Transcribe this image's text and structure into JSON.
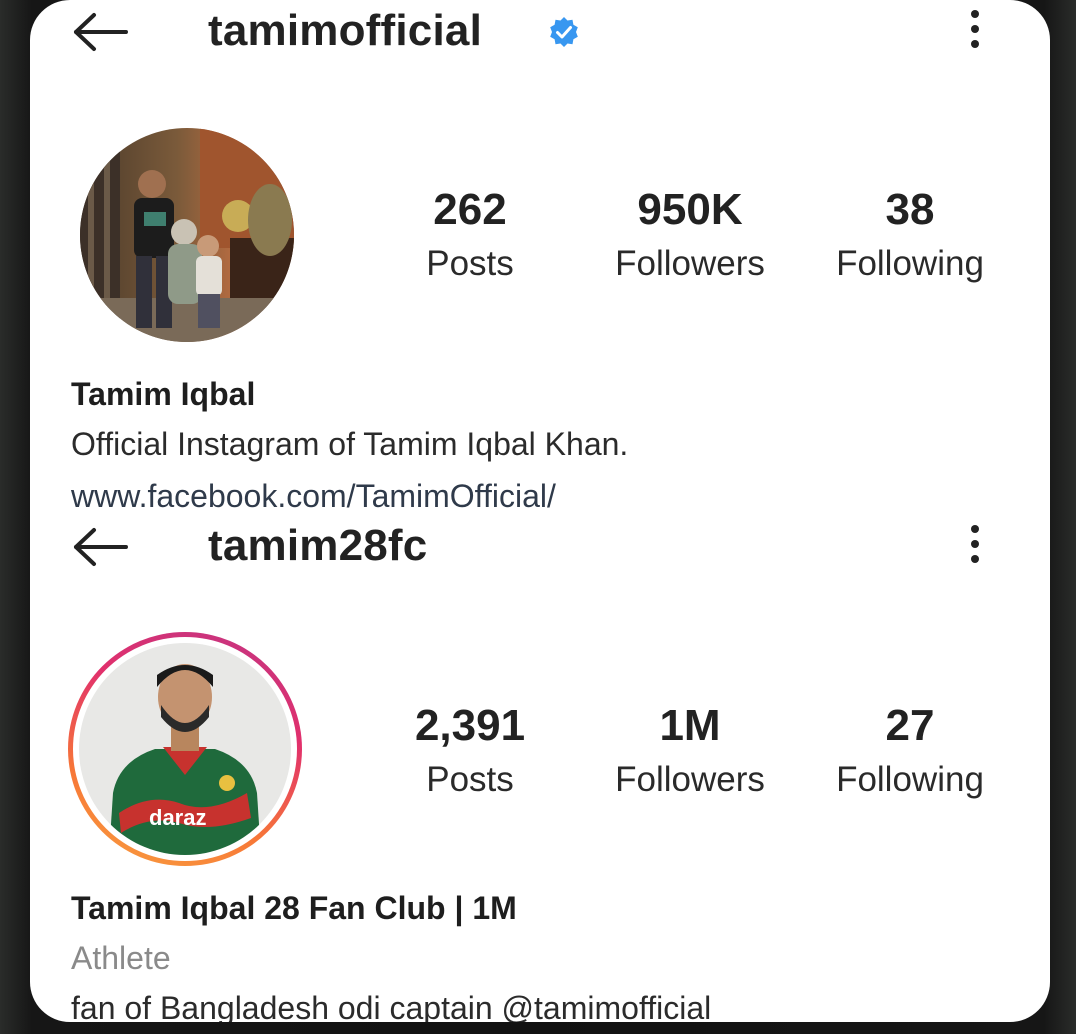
{
  "profiles": [
    {
      "username": "tamimofficial",
      "verified": true,
      "stats": [
        {
          "count": "262",
          "label": "Posts"
        },
        {
          "count": "950K",
          "label": "Followers"
        },
        {
          "count": "38",
          "label": "Following"
        }
      ],
      "name": "Tamim Iqbal",
      "bio": "Official Instagram of Tamim Iqbal Khan.",
      "link": "www.facebook.com/TamimOfficial/"
    },
    {
      "username": "tamim28fc",
      "verified": false,
      "stats": [
        {
          "count": "2,391",
          "label": "Posts"
        },
        {
          "count": "1M",
          "label": "Followers"
        },
        {
          "count": "27",
          "label": "Following"
        }
      ],
      "name": "Tamim Iqbal 28 Fan Club | 1M",
      "category": "Athlete",
      "bio": "fan of Bangladesh odi captain @tamimofficial"
    }
  ],
  "icons": {
    "back": "arrow-left-icon",
    "more": "vertical-dots-icon",
    "verified": "verified-badge-icon"
  },
  "colors": {
    "verified_blue": "#3897f0",
    "story_ring_start": "#f9a03f",
    "story_ring_end": "#c13584"
  },
  "jersey_logo": "daraz"
}
